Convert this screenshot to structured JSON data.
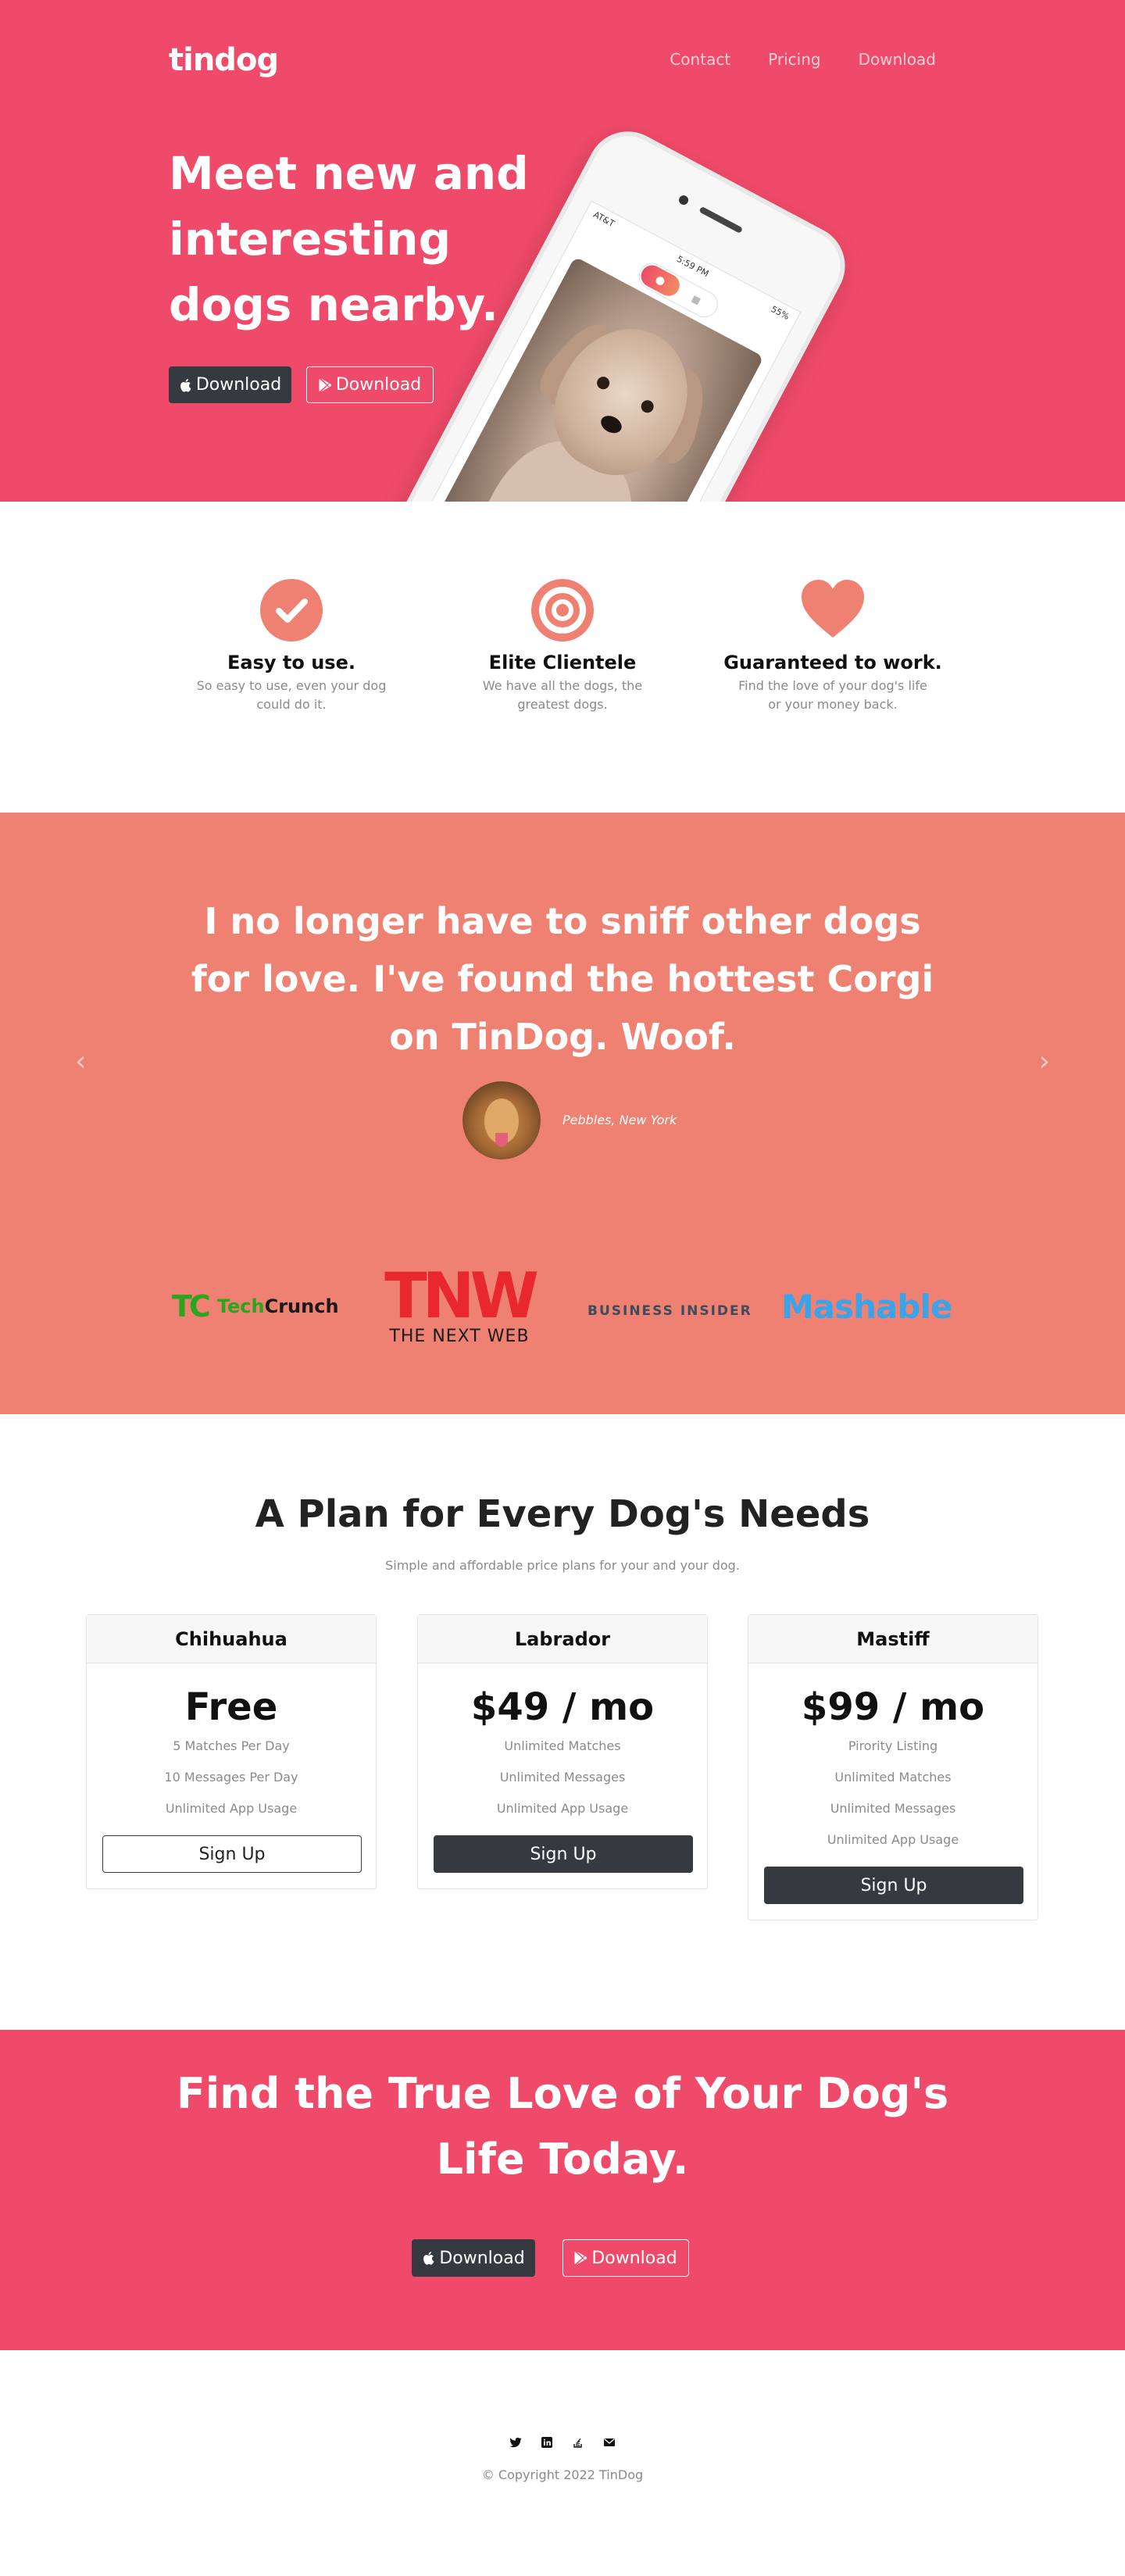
{
  "colors": {
    "primary": "#ef4a69",
    "secondary": "#ef8172",
    "dark": "#343a40",
    "muted": "#8a8a8a"
  },
  "nav": {
    "brand": "tindog",
    "links": [
      "Contact",
      "Pricing",
      "Download"
    ]
  },
  "hero": {
    "title": "Meet new and interesting dogs nearby.",
    "apple_button": "Download",
    "google_button": "Download",
    "phone": {
      "carrier": "AT&T",
      "time": "5:59 PM",
      "battery": "55%"
    }
  },
  "features": [
    {
      "icon": "check-circle-icon",
      "title": "Easy to use.",
      "text": "So easy to use, even your dog could do it."
    },
    {
      "icon": "target-icon",
      "title": "Elite Clientele",
      "text": "We have all the dogs, the greatest dogs."
    },
    {
      "icon": "heart-icon",
      "title": "Guaranteed to work.",
      "text": "Find the love of your dog's life or your money back."
    }
  ],
  "testimonial": {
    "quote": "I no longer have to sniff other dogs for love. I've found the hottest Corgi on TinDog. Woof.",
    "author": "Pebbles, New York"
  },
  "press": {
    "techcrunch_mark": "TC",
    "techcrunch_tech": "Tech",
    "techcrunch_crunch": "Crunch",
    "tnw_mark": "TNW",
    "tnw_sub": "THE NEXT WEB",
    "business_insider": "BUSINESS INSIDER",
    "mashable": "Mashable"
  },
  "pricing": {
    "title": "A Plan for Every Dog's Needs",
    "subtitle": "Simple and affordable price plans for your and your dog.",
    "plans": [
      {
        "name": "Chihuahua",
        "price": "Free",
        "features": [
          "5 Matches Per Day",
          "10 Messages Per Day",
          "Unlimited App Usage"
        ],
        "button": "Sign Up"
      },
      {
        "name": "Labrador",
        "price": "$49 / mo",
        "features": [
          "Unlimited Matches",
          "Unlimited Messages",
          "Unlimited App Usage"
        ],
        "button": "Sign Up"
      },
      {
        "name": "Mastiff",
        "price": "$99 / mo",
        "features": [
          "Pirority Listing",
          "Unlimited Matches",
          "Unlimited Messages",
          "Unlimited App Usage"
        ],
        "button": "Sign Up"
      }
    ]
  },
  "cta": {
    "title": "Find the True Love of Your Dog's Life Today.",
    "apple_button": "Download",
    "google_button": "Download"
  },
  "footer": {
    "social_icons": [
      "twitter-icon",
      "linkedin-icon",
      "stack-overflow-icon",
      "envelope-icon"
    ],
    "copyright": "© Copyright 2022 TinDog"
  }
}
